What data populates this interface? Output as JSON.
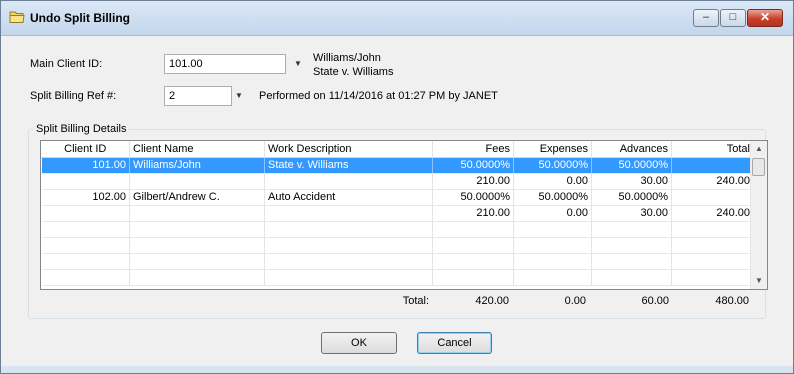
{
  "window": {
    "title": "Undo Split Billing",
    "controls": {
      "minimize": "–",
      "maximize": "□",
      "close": "✕"
    }
  },
  "form": {
    "main_client_label": "Main Client ID:",
    "main_client_value": "101.00",
    "client_name": "Williams/John",
    "client_matter": "State v. Williams",
    "split_ref_label": "Split Billing Ref #:",
    "split_ref_value": "2",
    "performed_text": "Performed on 11/14/2016 at 01:27 PM by JANET"
  },
  "details": {
    "group_label": "Split Billing Details",
    "columns": [
      "Client ID",
      "Client Name",
      "Work Description",
      "Fees",
      "Expenses",
      "Advances",
      "Total"
    ],
    "rows": [
      [
        "101.00",
        "Williams/John",
        "State v. Williams",
        "50.0000%",
        "50.0000%",
        "50.0000%",
        ""
      ],
      [
        "",
        "",
        "",
        "210.00",
        "0.00",
        "30.00",
        "240.00"
      ],
      [
        "102.00",
        "Gilbert/Andrew C.",
        "Auto Accident",
        "50.0000%",
        "50.0000%",
        "50.0000%",
        ""
      ],
      [
        "",
        "",
        "",
        "210.00",
        "0.00",
        "30.00",
        "240.00"
      ],
      [
        "",
        "",
        "",
        "",
        "",
        "",
        ""
      ],
      [
        "",
        "",
        "",
        "",
        "",
        "",
        ""
      ],
      [
        "",
        "",
        "",
        "",
        "",
        "",
        ""
      ],
      [
        "",
        "",
        "",
        "",
        "",
        "",
        ""
      ]
    ],
    "selected_row": 0,
    "totals": {
      "label": "Total:",
      "fees": "420.00",
      "expenses": "0.00",
      "advances": "60.00",
      "total": "480.00"
    }
  },
  "buttons": {
    "ok": "OK",
    "cancel": "Cancel"
  },
  "icons": {
    "title_icon": "folder-icon",
    "dropdown": "chevron-down-icon"
  },
  "colors": {
    "selection": "#3399ff",
    "title_bg": "#c3d6ec",
    "close": "#c7402b"
  }
}
